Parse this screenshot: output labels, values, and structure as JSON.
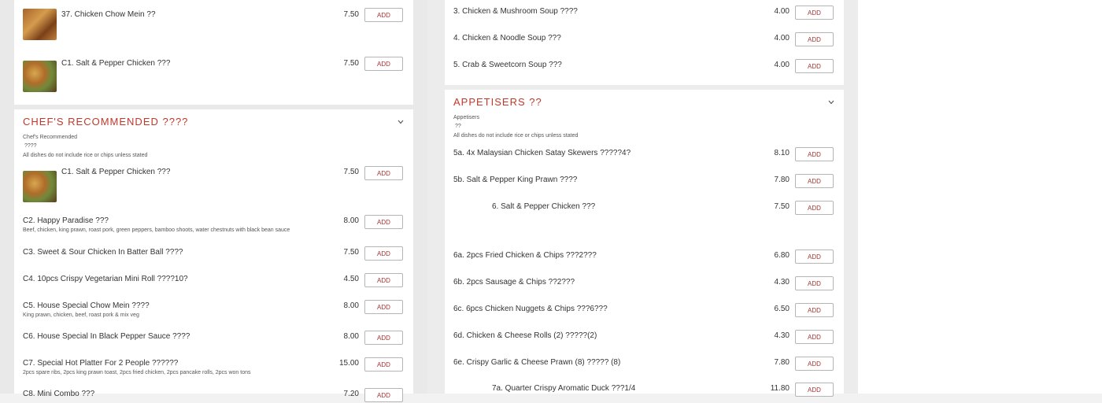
{
  "button_label": "ADD",
  "colors": {
    "accent": "#c0392b",
    "card": "#ffffff",
    "background": "#ececec"
  },
  "left": {
    "top_items": [
      {
        "name": "37. Chicken Chow Mein ??",
        "price": "7.50",
        "image": "chow-mein-image"
      },
      {
        "name": "C1. Salt & Pepper Chicken ???",
        "price": "7.50",
        "image": "salt-pepper-chicken-image"
      }
    ],
    "section": {
      "title": "CHEF'S RECOMMENDED ????",
      "desc_title": "Chef's Recommended",
      "desc_cn": "????",
      "desc_note": "All dishes do not include rice or chips unless stated",
      "items": [
        {
          "name": "C1. Salt & Pepper Chicken ???",
          "price": "7.50",
          "desc": ""
        },
        {
          "name": "C2. Happy Paradise ???",
          "price": "8.00",
          "desc": "Beef, chicken, king prawn, roast pork, green peppers, bamboo shoots, water chestnuts with black bean sauce"
        },
        {
          "name": "C3. Sweet & Sour Chicken In Batter Ball ????",
          "price": "7.50",
          "desc": ""
        },
        {
          "name": "C4. 10pcs Crispy Vegetarian Mini Roll ????10?",
          "price": "4.50",
          "desc": ""
        },
        {
          "name": "C5. House Special Chow Mein ????",
          "price": "8.00",
          "desc": "King prawn, chicken, beef, roast pork & mix veg"
        },
        {
          "name": "C6. House Special In Black Pepper Sauce ????",
          "price": "8.00",
          "desc": ""
        },
        {
          "name": "C7. Special Hot Platter For 2 People ??????",
          "price": "15.00",
          "desc": "2pcs spare ribs, 2pcs king prawn toast, 2pcs fried chicken, 2pcs pancake rolls, 2pcs won tons"
        },
        {
          "name": "C8. Mini Combo ???",
          "price": "7.20",
          "desc": ""
        }
      ]
    }
  },
  "right": {
    "soups": [
      {
        "name": "3. Chicken & Mushroom Soup ????",
        "price": "4.00"
      },
      {
        "name": "4. Chicken & Noodle Soup ???",
        "price": "4.00"
      },
      {
        "name": "5. Crab & Sweetcorn Soup ???",
        "price": "4.00"
      }
    ],
    "section": {
      "title": "APPETISERS ??",
      "desc_title": "Appetisers",
      "desc_cn": "??",
      "desc_note": "All dishes do not include rice or chips unless stated",
      "items": [
        {
          "name": "5a. 4x Malaysian Chicken Satay Skewers ?????4?",
          "price": "8.10"
        },
        {
          "name": "5b. Salt & Pepper King Prawn ????",
          "price": "7.80"
        },
        {
          "name": "6. Salt & Pepper Chicken ???",
          "price": "7.50"
        },
        {
          "name": "6a. 2pcs Fried Chicken & Chips ???2???",
          "price": "6.80"
        },
        {
          "name": "6b. 2pcs Sausage & Chips ??2???",
          "price": "4.30"
        },
        {
          "name": "6c. 6pcs Chicken Nuggets & Chips ???6???",
          "price": "6.50"
        },
        {
          "name": "6d. Chicken & Cheese Rolls (2) ?????(2)",
          "price": "4.30"
        },
        {
          "name": "6e. Crispy Garlic & Cheese Prawn (8) ????? (8)",
          "price": "7.80"
        },
        {
          "name": "7a. Quarter Crispy Aromatic Duck ???1/4",
          "price": "11.80"
        }
      ]
    }
  }
}
